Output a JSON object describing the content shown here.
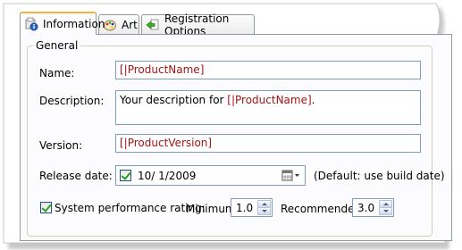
{
  "tabs": [
    {
      "label": "Information",
      "icon": "info-package-icon",
      "active": true
    },
    {
      "label": "Art",
      "icon": "palette-icon",
      "active": false
    },
    {
      "label": "Registration Options",
      "icon": "green-arrow-icon",
      "active": false
    }
  ],
  "group": {
    "title": "General"
  },
  "form": {
    "name_label": "Name:",
    "name_value": "[|ProductName]",
    "description_label": "Description:",
    "description_prefix": "Your description for ",
    "description_macro": "[|ProductName]",
    "description_suffix": ".",
    "version_label": "Version:",
    "version_value": "[|ProductVersion]",
    "release_label": "Release date:",
    "release_checked": true,
    "release_value": "10/  1/2009",
    "release_note": "(Default: use build date)",
    "perf_label": "System performance rating:",
    "perf_checked": true,
    "min_label": "Minimum:",
    "min_value": "1.0",
    "rec_label": "Recommended:",
    "rec_value": "3.0"
  },
  "colors": {
    "macro": "#a31515",
    "active_tab_accent": "#f4b23a",
    "border": "#919b9c",
    "field_border": "#7f9db9"
  }
}
